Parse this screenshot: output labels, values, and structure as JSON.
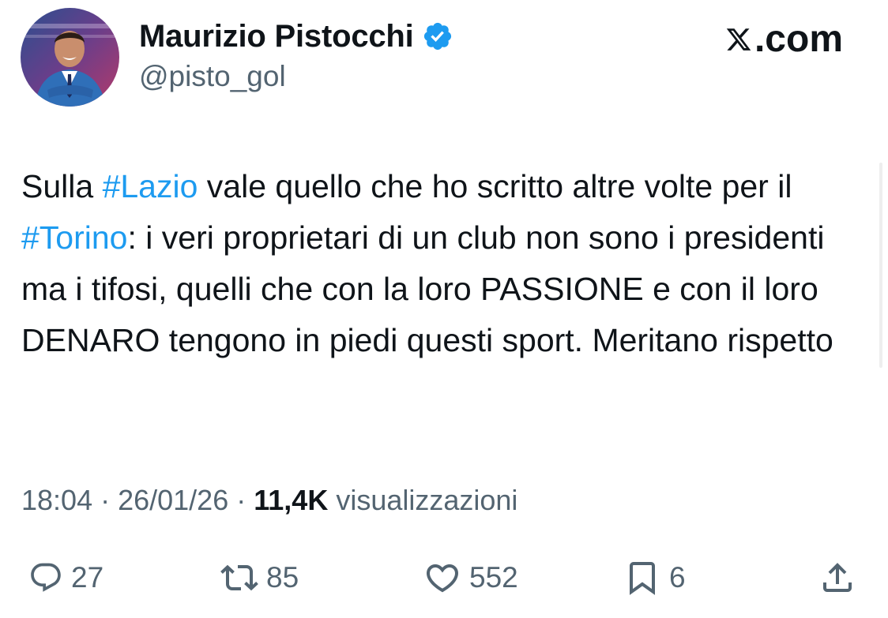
{
  "author": {
    "display_name": "Maurizio Pistocchi",
    "handle": "@pisto_gol",
    "verified": true,
    "verified_color": "#1d9bf0"
  },
  "site": {
    "label": ".com",
    "logo_icon": "x-logo-icon"
  },
  "tweet": {
    "segments": [
      {
        "text": "Sulla ",
        "type": "text"
      },
      {
        "text": "#Lazio",
        "type": "hashtag"
      },
      {
        "text": " vale quello che ho scritto altre volte per il ",
        "type": "text"
      },
      {
        "text": "#Torino",
        "type": "hashtag"
      },
      {
        "text": ": i veri proprietari di un club non sono i presidenti ma i tifosi, quelli che con la loro PASSIONE e con il loro DENARO tengono in piedi questi sport. Meritano rispetto",
        "type": "text"
      }
    ],
    "hashtag_color": "#1d9bf0"
  },
  "meta": {
    "time": "18:04",
    "separator": " · ",
    "date": "26/01/26",
    "views_count": "11,4K",
    "views_label": "visualizzazioni"
  },
  "actions": {
    "replies": "27",
    "reposts": "85",
    "likes": "552",
    "bookmarks": "6",
    "icons": [
      "reply-icon",
      "retweet-icon",
      "heart-icon",
      "bookmark-icon",
      "share-icon"
    ]
  },
  "colors": {
    "text": "#0f1419",
    "secondary": "#536471",
    "accent": "#1d9bf0"
  }
}
